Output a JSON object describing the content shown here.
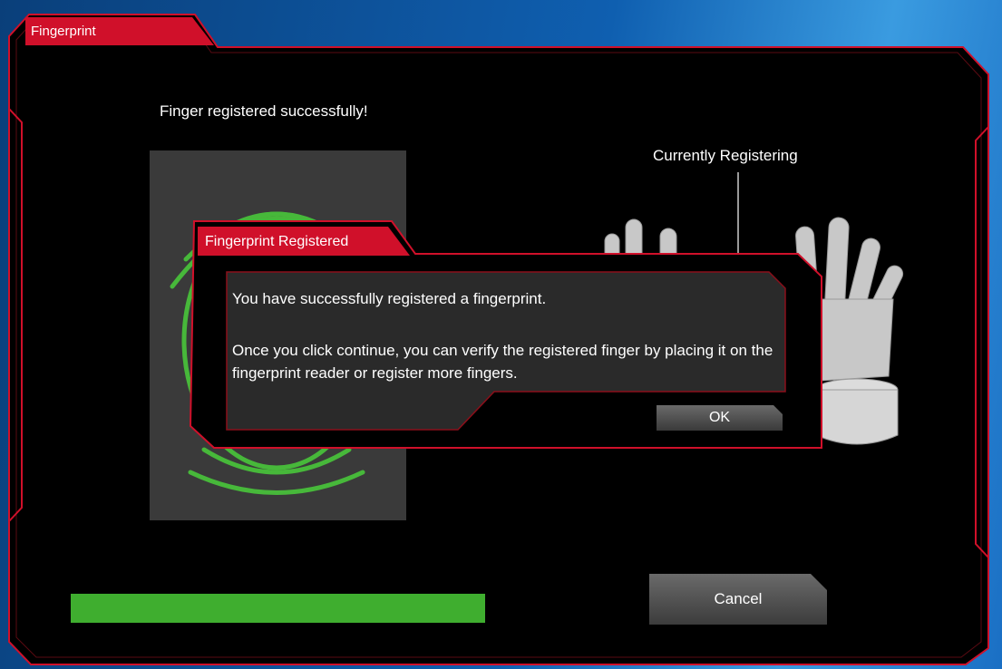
{
  "window": {
    "title": "Fingerprint",
    "status_message": "Finger registered successfully!",
    "current_label": "Currently Registering",
    "cancel_label": "Cancel",
    "progress_fraction": 1.0
  },
  "dialog": {
    "title": "Fingerprint Registered",
    "message_line1": "You have successfully registered a fingerprint.",
    "message_line2": "Once you click continue, you can verify the registered finger by placing it on the fingerprint reader or register more fingers.",
    "ok_label": "OK"
  },
  "icons": {
    "fingerprint": "fingerprint-icon",
    "hand": "hand-icon"
  },
  "colors": {
    "accent_red": "#d0102a",
    "progress_green": "#3fae2f",
    "fingerprint_green": "#47b83a",
    "window_bg": "#000000"
  }
}
